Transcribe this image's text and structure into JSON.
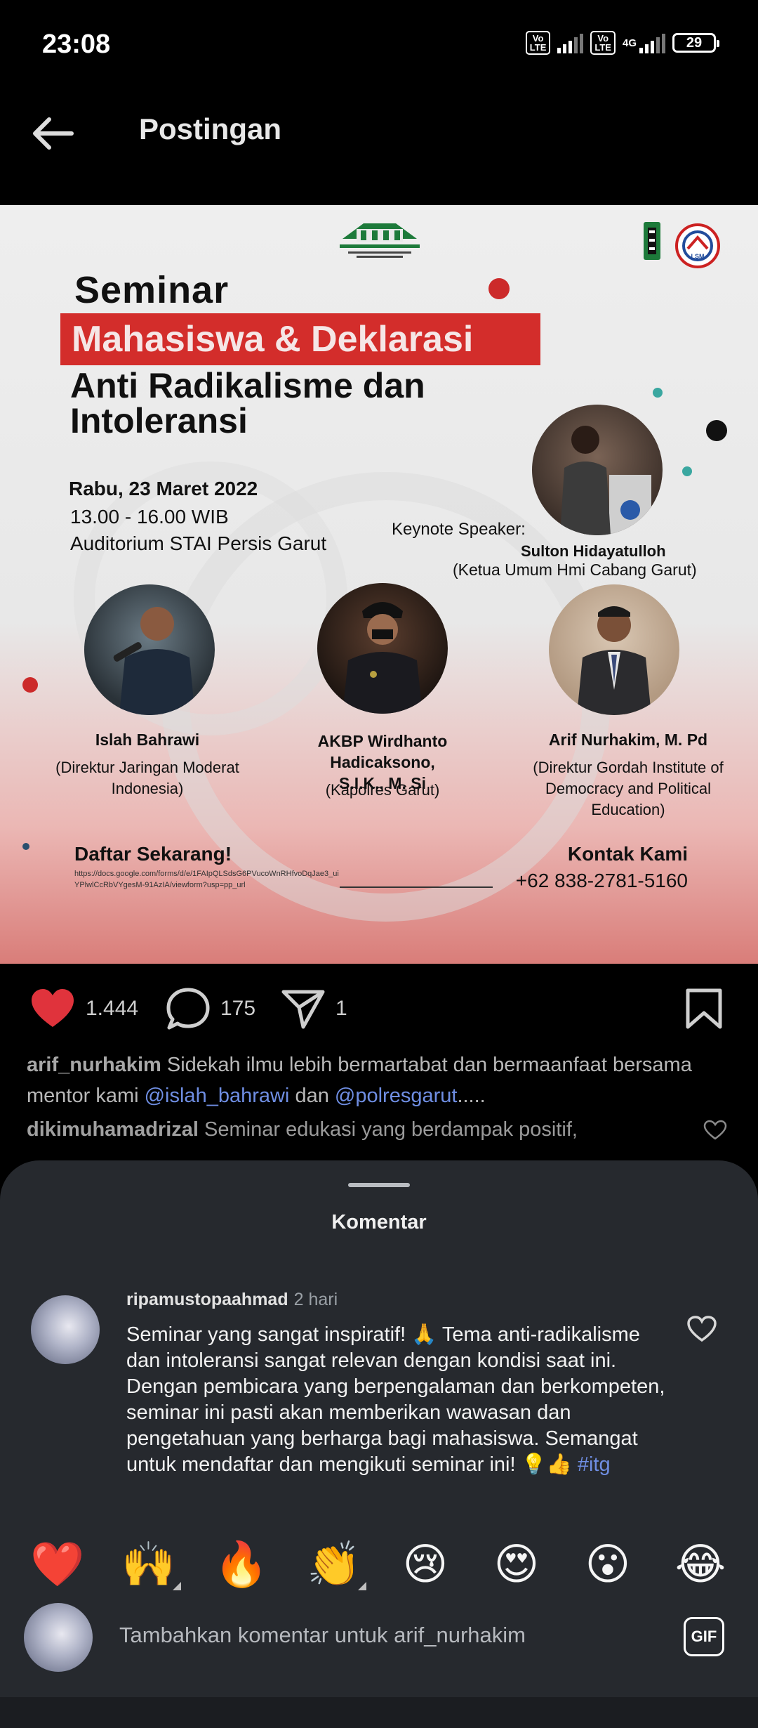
{
  "status_bar": {
    "time": "23:08",
    "sim1_badge": "Vo LTE",
    "sim2_badge": "Vo LTE",
    "network_type": "4G",
    "battery_level": "29"
  },
  "header": {
    "title": "Postingan",
    "back_icon": "arrow-left-icon"
  },
  "poster": {
    "title_line1": "Seminar",
    "title_banner": "Mahasiswa & Deklarasi",
    "title_line3": "Anti Radikalisme dan",
    "title_line4": "Intoleransi",
    "date": "Rabu, 23 Maret 2022",
    "time": "13.00 - 16.00 WIB",
    "venue": "Auditorium STAI Persis Garut",
    "keynote_label": "Keynote Speaker:",
    "keynote_name": "Sulton Hidayatulloh",
    "keynote_role": "(Ketua Umum Hmi Cabang Garut)",
    "speakers": [
      {
        "name": "Islah Bahrawi",
        "role_line1": "(Direktur Jaringan Moderat",
        "role_line2": "Indonesia)"
      },
      {
        "name_line1": "AKBP Wirdhanto Hadicaksono,",
        "name_line2": "S.I.K., M. Si",
        "role": "(Kapolres Garut)"
      },
      {
        "name": "Arif Nurhakim, M. Pd",
        "role_line1": "(Direktur Gordah Institute of",
        "role_line2": "Democracy and Political",
        "role_line3": "Education)"
      }
    ],
    "register_label": "Daftar Sekarang!",
    "register_url": "https://docs.google.com/forms/d/e/1FAIpQLSdsG6PVucoWnRHfvoDqJae3_uiYPlwlCcRbVYgesM-91AzIA/viewform?usp=pp_url",
    "contact_label": "Kontak Kami",
    "contact_phone": "+62 838-2781-5160",
    "org_logo_text": "HIMPUNAN MAHASISWA ISLAM CABANG GARUT"
  },
  "actions": {
    "likes": "1.444",
    "comments": "175",
    "shares": "1"
  },
  "caption": {
    "username": "arif_nurhakim",
    "text_part1": "Sidekah ilmu lebih bermartabat dan bermaanfaat bersama mentor kami",
    "mention1": "@islah_bahrawi",
    "text_part2": "dan",
    "mention2": "@polresgarut",
    "ellipsis": "....."
  },
  "preview_comment": {
    "username": "dikimuhamadrizal",
    "text": "Seminar edukasi yang berdampak positif,"
  },
  "comments_sheet": {
    "title": "Komentar",
    "comment": {
      "username": "ripamustopaahmad",
      "time": "2 hari",
      "text": "Seminar yang sangat inspiratif! 🙏 Tema anti-radikalisme dan intoleransi sangat relevan dengan kondisi saat ini. Dengan pembicara yang berpengalaman dan berkompeten, seminar ini pasti akan memberikan wawasan dan pengetahuan yang berharga bagi mahasiswa. Semangat untuk mendaftar dan mengikuti seminar ini! 💡👍",
      "hashtag": "#itg"
    },
    "quick_emojis": [
      "❤️",
      "🙌",
      "🔥",
      "👏",
      "😢",
      "😍",
      "😮",
      "😂"
    ],
    "input_placeholder": "Tambahkan komentar untuk arif_nurhakim",
    "gif_label": "GIF"
  },
  "colors": {
    "accent_red": "#d32d2b",
    "heart_red": "#e0333c",
    "mention_blue": "#6f8ee3",
    "sheet_bg": "#26292e"
  }
}
